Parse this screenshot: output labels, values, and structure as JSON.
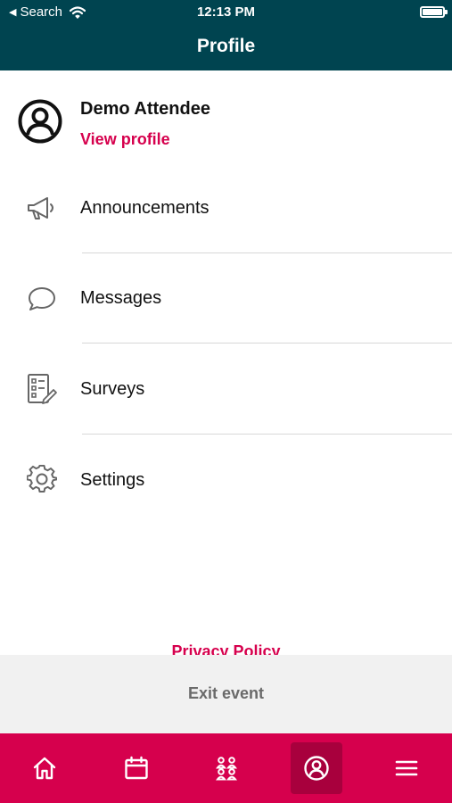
{
  "status_bar": {
    "back_label": "Search",
    "time": "12:13 PM"
  },
  "header": {
    "title": "Profile"
  },
  "profile": {
    "name": "Demo Attendee",
    "view_profile_label": "View profile"
  },
  "menu": {
    "items": [
      {
        "label": "Announcements",
        "icon": "megaphone-icon"
      },
      {
        "label": "Messages",
        "icon": "chat-bubble-icon"
      },
      {
        "label": "Surveys",
        "icon": "survey-checklist-icon"
      },
      {
        "label": "Settings",
        "icon": "gear-icon"
      }
    ]
  },
  "footer": {
    "privacy_policy_label": "Privacy Policy",
    "exit_event_label": "Exit event"
  },
  "tabbar": {
    "tabs": [
      {
        "icon": "home-icon",
        "active": false
      },
      {
        "icon": "calendar-icon",
        "active": false
      },
      {
        "icon": "people-icon",
        "active": false
      },
      {
        "icon": "profile-icon",
        "active": true
      },
      {
        "icon": "menu-icon",
        "active": false
      }
    ]
  },
  "colors": {
    "header_bg": "#004450",
    "accent": "#d6004d",
    "active_tab": "#a8003d",
    "exit_bar_bg": "#f1f1f1"
  }
}
